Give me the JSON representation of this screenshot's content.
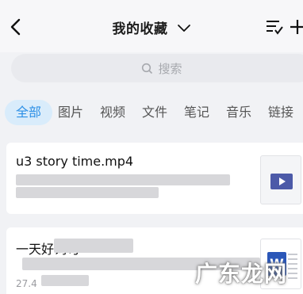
{
  "header": {
    "title": "我的收藏"
  },
  "search": {
    "placeholder": "搜索"
  },
  "tabs": [
    {
      "label": "全部",
      "active": true
    },
    {
      "label": "图片"
    },
    {
      "label": "视频"
    },
    {
      "label": "文件"
    },
    {
      "label": "笔记"
    },
    {
      "label": "音乐"
    },
    {
      "label": "链接"
    }
  ],
  "items": [
    {
      "title": "u3 story time.mp4",
      "thumb_icon": "video-play-icon"
    },
    {
      "title": "一天好词句",
      "date": "27.4",
      "thumb_icon": "word-doc-icon"
    }
  ],
  "watermark": "广东龙网",
  "colors": {
    "accent": "#2c8fe6",
    "tab_active_bg": "#d9ecfb",
    "word_blue": "#2b57b8",
    "video_badge": "#4c5aa8"
  }
}
